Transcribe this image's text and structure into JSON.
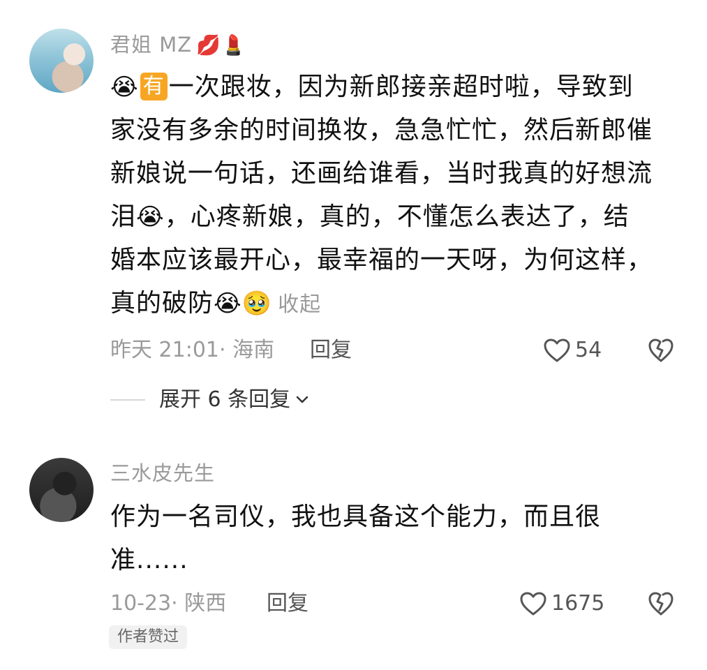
{
  "comments": [
    {
      "username": "君姐 MZ",
      "username_emojis": "💋💄",
      "line1_emojis": "😭",
      "tag": "有",
      "lines": [
        "一次跟妆，因为新郎接亲超时啦，导致到",
        "家没有多余的时间换妆，急急忙忙，然后新郎催",
        "新娘说一句话，还画给谁看，当时我真的好想流",
        "泪",
        "，心疼新娘，真的，不懂怎么表达了，结",
        "婚本应该最开心，最幸福的一天呀，为何这样，",
        "真的破防"
      ],
      "inline_emoji_cry": "😭",
      "end_emojis": "😭🥹",
      "collapse_label": "收起",
      "meta": "昨天 21:01· 海南",
      "reply_label": "回复",
      "likes": "54",
      "expand_label": "展开 6 条回复"
    },
    {
      "username": "三水皮先生",
      "lines": [
        "作为一名司仪，我也具备这个能力，而且很",
        "准......"
      ],
      "meta": "10-23· 陕西",
      "reply_label": "回复",
      "likes": "1675",
      "author_badge": "作者赞过"
    }
  ]
}
